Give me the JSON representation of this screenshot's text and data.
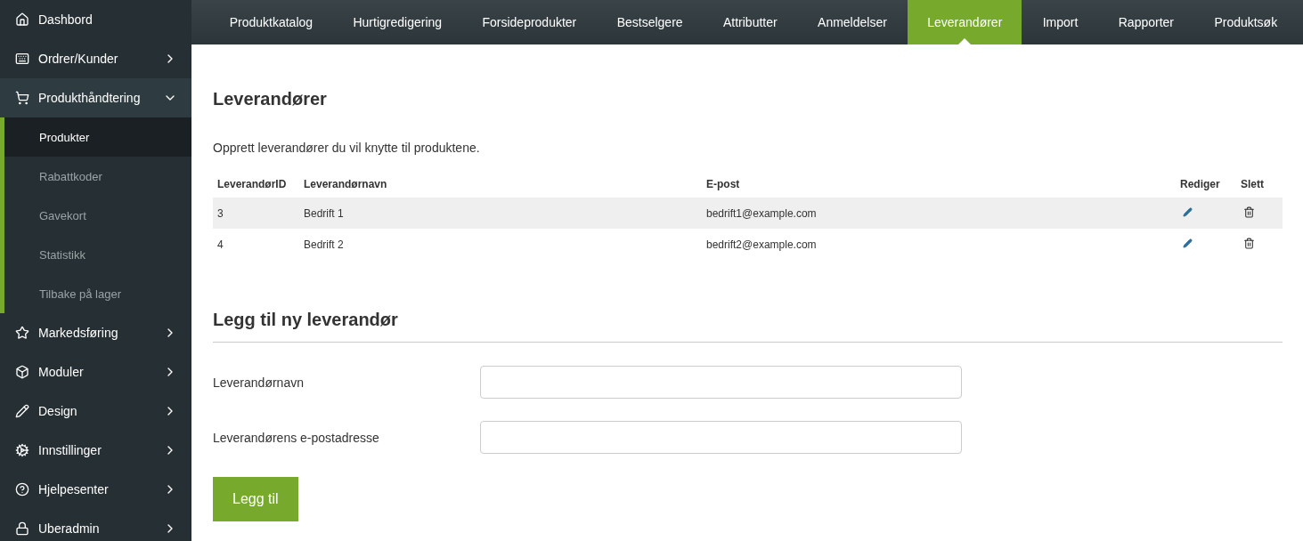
{
  "sidebar": {
    "items": [
      {
        "label": "Dashbord",
        "expanded": false,
        "has_children": false
      },
      {
        "label": "Ordrer/Kunder",
        "expanded": false,
        "has_children": true
      },
      {
        "label": "Produkthåndtering",
        "expanded": true,
        "has_children": true,
        "children": [
          {
            "label": "Produkter",
            "selected": true
          },
          {
            "label": "Rabattkoder",
            "selected": false
          },
          {
            "label": "Gavekort",
            "selected": false
          },
          {
            "label": "Statistikk",
            "selected": false
          },
          {
            "label": "Tilbake på lager",
            "selected": false
          }
        ]
      },
      {
        "label": "Markedsføring",
        "expanded": false,
        "has_children": true
      },
      {
        "label": "Moduler",
        "expanded": false,
        "has_children": true
      },
      {
        "label": "Design",
        "expanded": false,
        "has_children": true
      },
      {
        "label": "Innstillinger",
        "expanded": false,
        "has_children": true
      },
      {
        "label": "Hjelpesenter",
        "expanded": false,
        "has_children": true
      },
      {
        "label": "Uberadmin",
        "expanded": false,
        "has_children": true
      }
    ]
  },
  "tabs": [
    {
      "label": "Produktkatalog",
      "selected": false
    },
    {
      "label": "Hurtigredigering",
      "selected": false
    },
    {
      "label": "Forsideprodukter",
      "selected": false
    },
    {
      "label": "Bestselgere",
      "selected": false
    },
    {
      "label": "Attributter",
      "selected": false
    },
    {
      "label": "Anmeldelser",
      "selected": false
    },
    {
      "label": "Leverandører",
      "selected": true
    },
    {
      "label": "Import",
      "selected": false
    },
    {
      "label": "Rapporter",
      "selected": false
    },
    {
      "label": "Produktsøk",
      "selected": false
    }
  ],
  "heading": "Leverandører",
  "intro": "Opprett leverandører du vil knytte til produktene.",
  "table": {
    "columns": [
      "LeverandørID",
      "Leverandørnavn",
      "E-post",
      "Rediger",
      "Slett"
    ],
    "rows": [
      {
        "id": "3",
        "name": "Bedrift 1",
        "email": "bedrift1@example.com"
      },
      {
        "id": "4",
        "name": "Bedrift 2",
        "email": "bedrift2@example.com"
      }
    ]
  },
  "form": {
    "heading": "Legg til ny leverandør",
    "fields": [
      {
        "label": "Leverandørnavn"
      },
      {
        "label": "Leverandørens e-postadresse"
      }
    ],
    "submit": "Legg til"
  }
}
